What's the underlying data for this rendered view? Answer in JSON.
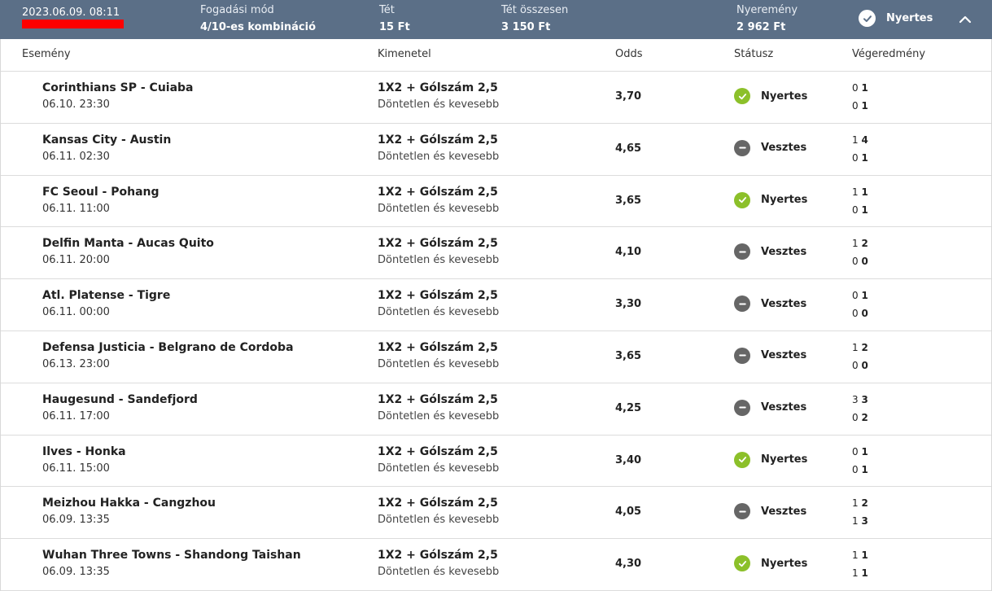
{
  "header": {
    "date": "2023.06.09. 08:11",
    "bet_type_label": "Fogadási mód",
    "bet_type_value": "4/10-es kombináció",
    "stake_label": "Tét",
    "stake_value": "15 Ft",
    "total_stake_label": "Tét összesen",
    "total_stake_value": "3 150 Ft",
    "winnings_label": "Nyeremény",
    "winnings_value": "2 962 Ft",
    "status_label": "Nyertes"
  },
  "columns": {
    "event": "Esemény",
    "outcome": "Kimenetel",
    "odds": "Odds",
    "status": "Státusz",
    "result": "Végeredmény"
  },
  "colors": {
    "header_bg": "#5b6f87",
    "win": "#8cc02a",
    "lose": "#666666"
  },
  "rows": [
    {
      "event": "Corinthians SP - Cuiaba",
      "time": "06.10. 23:30",
      "outcome": "1X2 + Gólszám 2,5",
      "outcome_sub": "Döntetlen és kevesebb",
      "odds": "3,70",
      "status": "Nyertes",
      "win": true,
      "r1a": "0",
      "r1b": "1",
      "r2a": "0",
      "r2b": "1"
    },
    {
      "event": "Kansas City - Austin",
      "time": "06.11. 02:30",
      "outcome": "1X2 + Gólszám 2,5",
      "outcome_sub": "Döntetlen és kevesebb",
      "odds": "4,65",
      "status": "Vesztes",
      "win": false,
      "r1a": "1",
      "r1b": "4",
      "r2a": "0",
      "r2b": "1"
    },
    {
      "event": "FC Seoul - Pohang",
      "time": "06.11. 11:00",
      "outcome": "1X2 + Gólszám 2,5",
      "outcome_sub": "Döntetlen és kevesebb",
      "odds": "3,65",
      "status": "Nyertes",
      "win": true,
      "r1a": "1",
      "r1b": "1",
      "r2a": "0",
      "r2b": "1"
    },
    {
      "event": "Delfin Manta - Aucas Quito",
      "time": "06.11. 20:00",
      "outcome": "1X2 + Gólszám 2,5",
      "outcome_sub": "Döntetlen és kevesebb",
      "odds": "4,10",
      "status": "Vesztes",
      "win": false,
      "r1a": "1",
      "r1b": "2",
      "r2a": "0",
      "r2b": "0"
    },
    {
      "event": "Atl. Platense - Tigre",
      "time": "06.11. 00:00",
      "outcome": "1X2 + Gólszám 2,5",
      "outcome_sub": "Döntetlen és kevesebb",
      "odds": "3,30",
      "status": "Vesztes",
      "win": false,
      "r1a": "0",
      "r1b": "1",
      "r2a": "0",
      "r2b": "0"
    },
    {
      "event": "Defensa Justicia - Belgrano de Cordoba",
      "time": "06.13. 23:00",
      "outcome": "1X2 + Gólszám 2,5",
      "outcome_sub": "Döntetlen és kevesebb",
      "odds": "3,65",
      "status": "Vesztes",
      "win": false,
      "r1a": "1",
      "r1b": "2",
      "r2a": "0",
      "r2b": "0"
    },
    {
      "event": "Haugesund - Sandefjord",
      "time": "06.11. 17:00",
      "outcome": "1X2 + Gólszám 2,5",
      "outcome_sub": "Döntetlen és kevesebb",
      "odds": "4,25",
      "status": "Vesztes",
      "win": false,
      "r1a": "3",
      "r1b": "3",
      "r2a": "0",
      "r2b": "2"
    },
    {
      "event": "Ilves - Honka",
      "time": "06.11. 15:00",
      "outcome": "1X2 + Gólszám 2,5",
      "outcome_sub": "Döntetlen és kevesebb",
      "odds": "3,40",
      "status": "Nyertes",
      "win": true,
      "r1a": "0",
      "r1b": "1",
      "r2a": "0",
      "r2b": "1"
    },
    {
      "event": "Meizhou Hakka - Cangzhou",
      "time": "06.09. 13:35",
      "outcome": "1X2 + Gólszám 2,5",
      "outcome_sub": "Döntetlen és kevesebb",
      "odds": "4,05",
      "status": "Vesztes",
      "win": false,
      "r1a": "1",
      "r1b": "2",
      "r2a": "1",
      "r2b": "3"
    },
    {
      "event": "Wuhan Three Towns - Shandong Taishan",
      "time": "06.09. 13:35",
      "outcome": "1X2 + Gólszám 2,5",
      "outcome_sub": "Döntetlen és kevesebb",
      "odds": "4,30",
      "status": "Nyertes",
      "win": true,
      "r1a": "1",
      "r1b": "1",
      "r2a": "1",
      "r2b": "1"
    }
  ]
}
